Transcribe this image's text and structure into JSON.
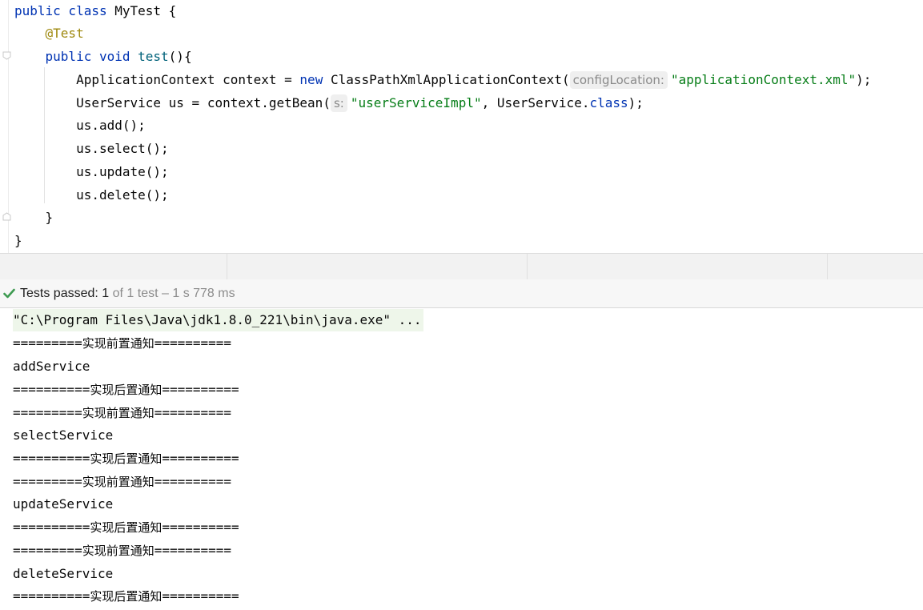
{
  "editor": {
    "lines": [
      {
        "parts": [
          {
            "t": "public class",
            "c": "kw"
          },
          {
            "t": " MyTest {",
            "c": ""
          }
        ]
      },
      {
        "parts": [
          {
            "t": "    ",
            "c": ""
          },
          {
            "t": "@Test",
            "c": "ann"
          }
        ]
      },
      {
        "parts": [
          {
            "t": "    ",
            "c": ""
          },
          {
            "t": "public void",
            "c": "kw"
          },
          {
            "t": " ",
            "c": ""
          },
          {
            "t": "test",
            "c": "fn"
          },
          {
            "t": "(){",
            "c": ""
          }
        ]
      },
      {
        "parts": [
          {
            "t": "        ApplicationContext context = ",
            "c": ""
          },
          {
            "t": "new",
            "c": "kw"
          },
          {
            "t": " ClassPathXmlApplicationContext(",
            "c": ""
          },
          {
            "t": "configLocation:",
            "c": "hint"
          },
          {
            "t": "\"applicationContext.xml\"",
            "c": "str"
          },
          {
            "t": ");",
            "c": ""
          }
        ]
      },
      {
        "parts": [
          {
            "t": "        UserService us = context.getBean(",
            "c": ""
          },
          {
            "t": "s:",
            "c": "hint"
          },
          {
            "t": "\"userServiceImpl\"",
            "c": "str"
          },
          {
            "t": ", UserService.",
            "c": ""
          },
          {
            "t": "class",
            "c": "kw"
          },
          {
            "t": ");",
            "c": ""
          }
        ]
      },
      {
        "parts": [
          {
            "t": "        us.add();",
            "c": ""
          }
        ]
      },
      {
        "parts": [
          {
            "t": "        us.select();",
            "c": ""
          }
        ]
      },
      {
        "parts": [
          {
            "t": "        us.update();",
            "c": ""
          }
        ]
      },
      {
        "parts": [
          {
            "t": "        us.delete();",
            "c": ""
          }
        ]
      },
      {
        "parts": [
          {
            "t": "    }",
            "c": ""
          }
        ]
      },
      {
        "parts": [
          {
            "t": "}",
            "c": ""
          }
        ]
      }
    ]
  },
  "test_status": {
    "check_icon": "check-icon",
    "label": "Tests passed: ",
    "count": "1",
    "detail": " of 1 test – 1 s 778 ms"
  },
  "console": {
    "lines": [
      "\"C:\\Program Files\\Java\\jdk1.8.0_221\\bin\\java.exe\" ...",
      "=========实现前置通知==========",
      "addService",
      "==========实现后置通知==========",
      "=========实现前置通知==========",
      "selectService",
      "==========实现后置通知==========",
      "=========实现前置通知==========",
      "updateService",
      "==========实现后置通知==========",
      "=========实现前置通知==========",
      "deleteService",
      "==========实现后置通知=========="
    ]
  },
  "colors": {
    "keyword": "#0033b3",
    "annotation": "#9e880d",
    "string": "#067d17",
    "method": "#00627a",
    "pass_green": "#3d9a50"
  }
}
